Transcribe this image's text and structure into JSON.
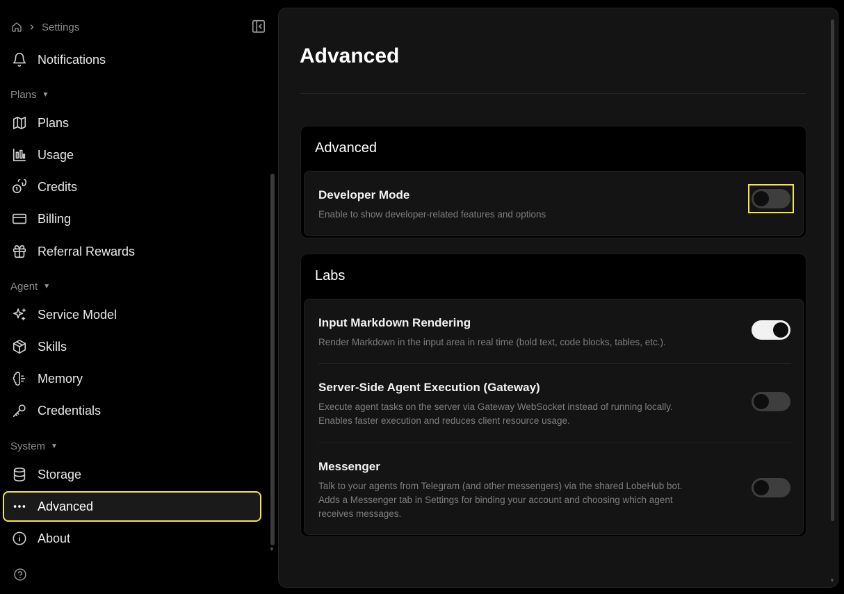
{
  "breadcrumb": {
    "label": "Settings"
  },
  "sidebar": {
    "items_top": [
      {
        "label": "Notifications",
        "icon": "bell-icon"
      }
    ],
    "groups": [
      {
        "label": "Plans",
        "items": [
          {
            "label": "Plans",
            "icon": "map-icon"
          },
          {
            "label": "Usage",
            "icon": "bar-chart-icon"
          },
          {
            "label": "Credits",
            "icon": "coins-icon"
          },
          {
            "label": "Billing",
            "icon": "credit-card-icon"
          },
          {
            "label": "Referral Rewards",
            "icon": "gift-icon"
          }
        ]
      },
      {
        "label": "Agent",
        "items": [
          {
            "label": "Service Model",
            "icon": "sparkles-icon"
          },
          {
            "label": "Skills",
            "icon": "box-icon"
          },
          {
            "label": "Memory",
            "icon": "brain-icon"
          },
          {
            "label": "Credentials",
            "icon": "key-icon"
          }
        ]
      },
      {
        "label": "System",
        "items": [
          {
            "label": "Storage",
            "icon": "database-icon"
          },
          {
            "label": "Advanced",
            "icon": "ellipsis-icon",
            "active": true
          },
          {
            "label": "About",
            "icon": "info-icon"
          }
        ]
      }
    ]
  },
  "main": {
    "title": "Advanced",
    "sections": [
      {
        "title": "Advanced",
        "settings": [
          {
            "title": "Developer Mode",
            "description": "Enable to show developer-related features and options",
            "enabled": false
          }
        ]
      },
      {
        "title": "Labs",
        "settings": [
          {
            "title": "Input Markdown Rendering",
            "description": "Render Markdown in the input area in real time (bold text, code blocks, tables, etc.).",
            "enabled": true
          },
          {
            "title": "Server-Side Agent Execution (Gateway)",
            "description_line1": "Execute agent tasks on the server via Gateway WebSocket instead of running locally.",
            "description_line2": "Enables faster execution and reduces client resource usage.",
            "enabled": false
          },
          {
            "title": "Messenger",
            "description_line1": "Talk to your agents from Telegram (and other messengers) via the shared LobeHub bot.",
            "description_line2": "Adds a Messenger tab in Settings for binding your account and choosing which agent",
            "description_line3": "receives messages.",
            "enabled": false
          }
        ]
      }
    ]
  },
  "colors": {
    "highlight": "#f5e64a",
    "background": "#000000",
    "panel": "#141414"
  }
}
